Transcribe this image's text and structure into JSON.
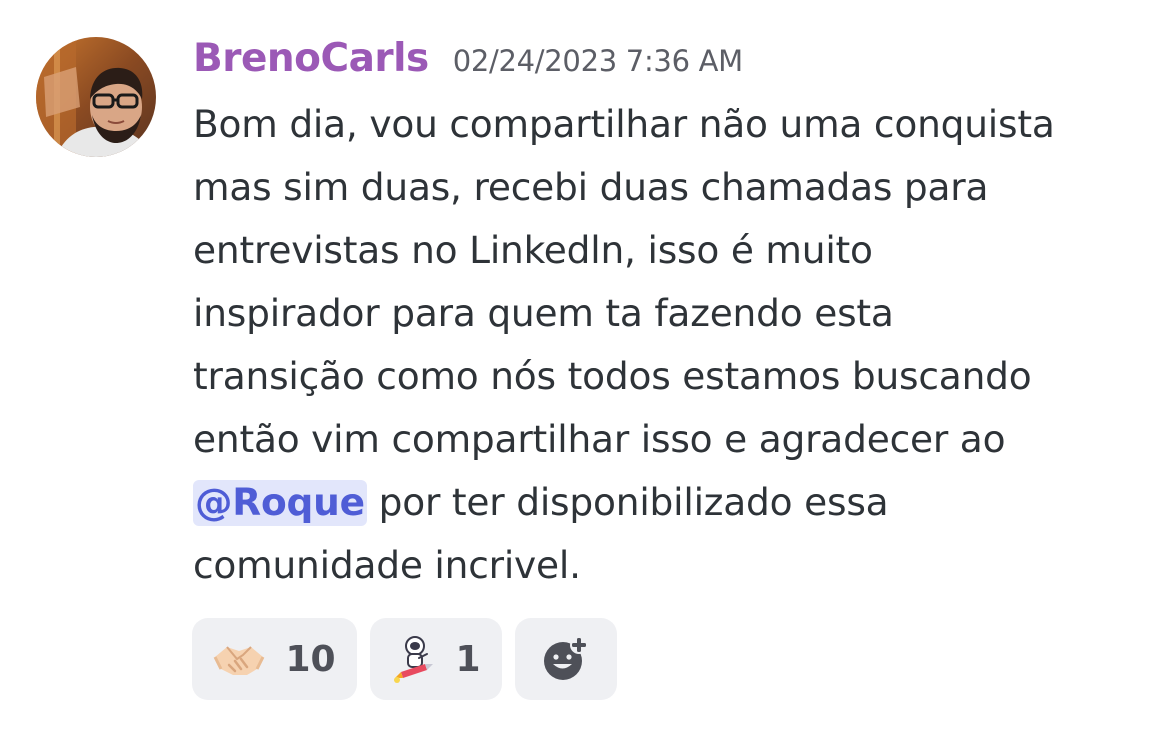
{
  "message": {
    "author": "BrenoCarls",
    "timestamp": "02/24/2023 7:36 AM",
    "lines": [
      "Bom dia, vou compartilhar não uma conquista",
      "mas sim duas, recebi duas chamadas para",
      "entrevistas no Linkedln, isso é muito",
      "inspirador para quem ta fazendo esta",
      "transição como nós todos estamos buscando",
      "então vim compartilhar isso e agradecer ao"
    ],
    "mention": "@Roque",
    "after_mention": " por ter disponibilizado essa",
    "last_line": "comunidade incrivel."
  },
  "reactions": [
    {
      "emoji": "handshake-icon",
      "count": "10"
    },
    {
      "emoji": "astronaut-rocket-icon",
      "count": "1"
    }
  ],
  "add_reaction": {
    "icon": "add-reaction-icon"
  },
  "colors": {
    "author": "#9b59b6",
    "mention_bg": "#e2e6fb",
    "mention_text": "#4f5dd6",
    "reaction_bg": "#eff0f3"
  }
}
